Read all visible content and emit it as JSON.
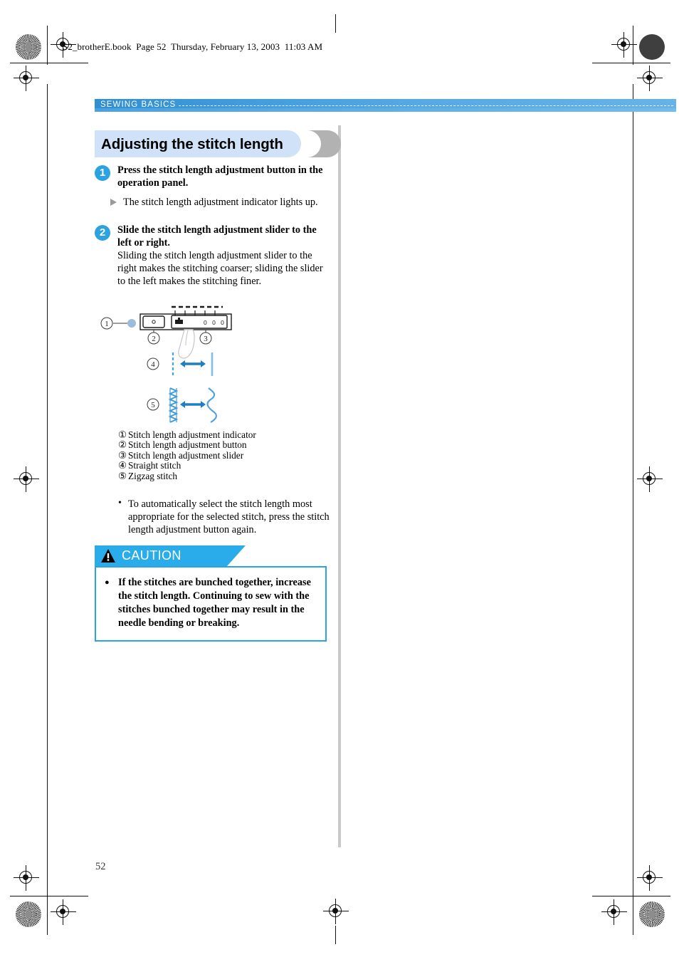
{
  "page": {
    "slug": "S2_brotherE.book  Page 52  Thursday, February 13, 2003  11:03 AM",
    "folio": "52"
  },
  "running_head": {
    "label": "SEWING BASICS"
  },
  "section": {
    "title": "Adjusting the stitch length"
  },
  "steps": [
    {
      "number": "1",
      "title": "Press the stitch length adjustment button in the operation panel.",
      "body": "",
      "result": "The stitch length adjustment indicator lights up."
    },
    {
      "number": "2",
      "title": "Slide the stitch length adjustment slider to the left or right.",
      "body": "Sliding the stitch length adjustment slider to the right makes the stitching coarser; sliding the slider to the left makes the stitching finer.",
      "result": ""
    }
  ],
  "figure": {
    "callouts": [
      "1",
      "2",
      "3",
      "4",
      "5"
    ],
    "panel_digits": "0 0 0"
  },
  "key_list": [
    {
      "marker": "1",
      "label": "Stitch length adjustment indicator"
    },
    {
      "marker": "2",
      "label": "Stitch length adjustment button"
    },
    {
      "marker": "3",
      "label": "Stitch length adjustment slider"
    },
    {
      "marker": "4",
      "label": "Straight stitch"
    },
    {
      "marker": "5",
      "label": "Zigzag stitch"
    }
  ],
  "note": "To automatically select the stitch length most appropriate for the selected stitch, press the stitch length adjustment button again.",
  "caution": {
    "label": "CAUTION",
    "item": "If the stitches are bunched together, increase the stitch length. Continuing to sew with the stitches bunched together may result in the needle bending or breaking."
  },
  "colors": {
    "accent_blue": "#2ba3e3",
    "caution_blue": "#2bacea",
    "title_pill": "#cfe2f7",
    "band_blue": "#3f9adc"
  }
}
